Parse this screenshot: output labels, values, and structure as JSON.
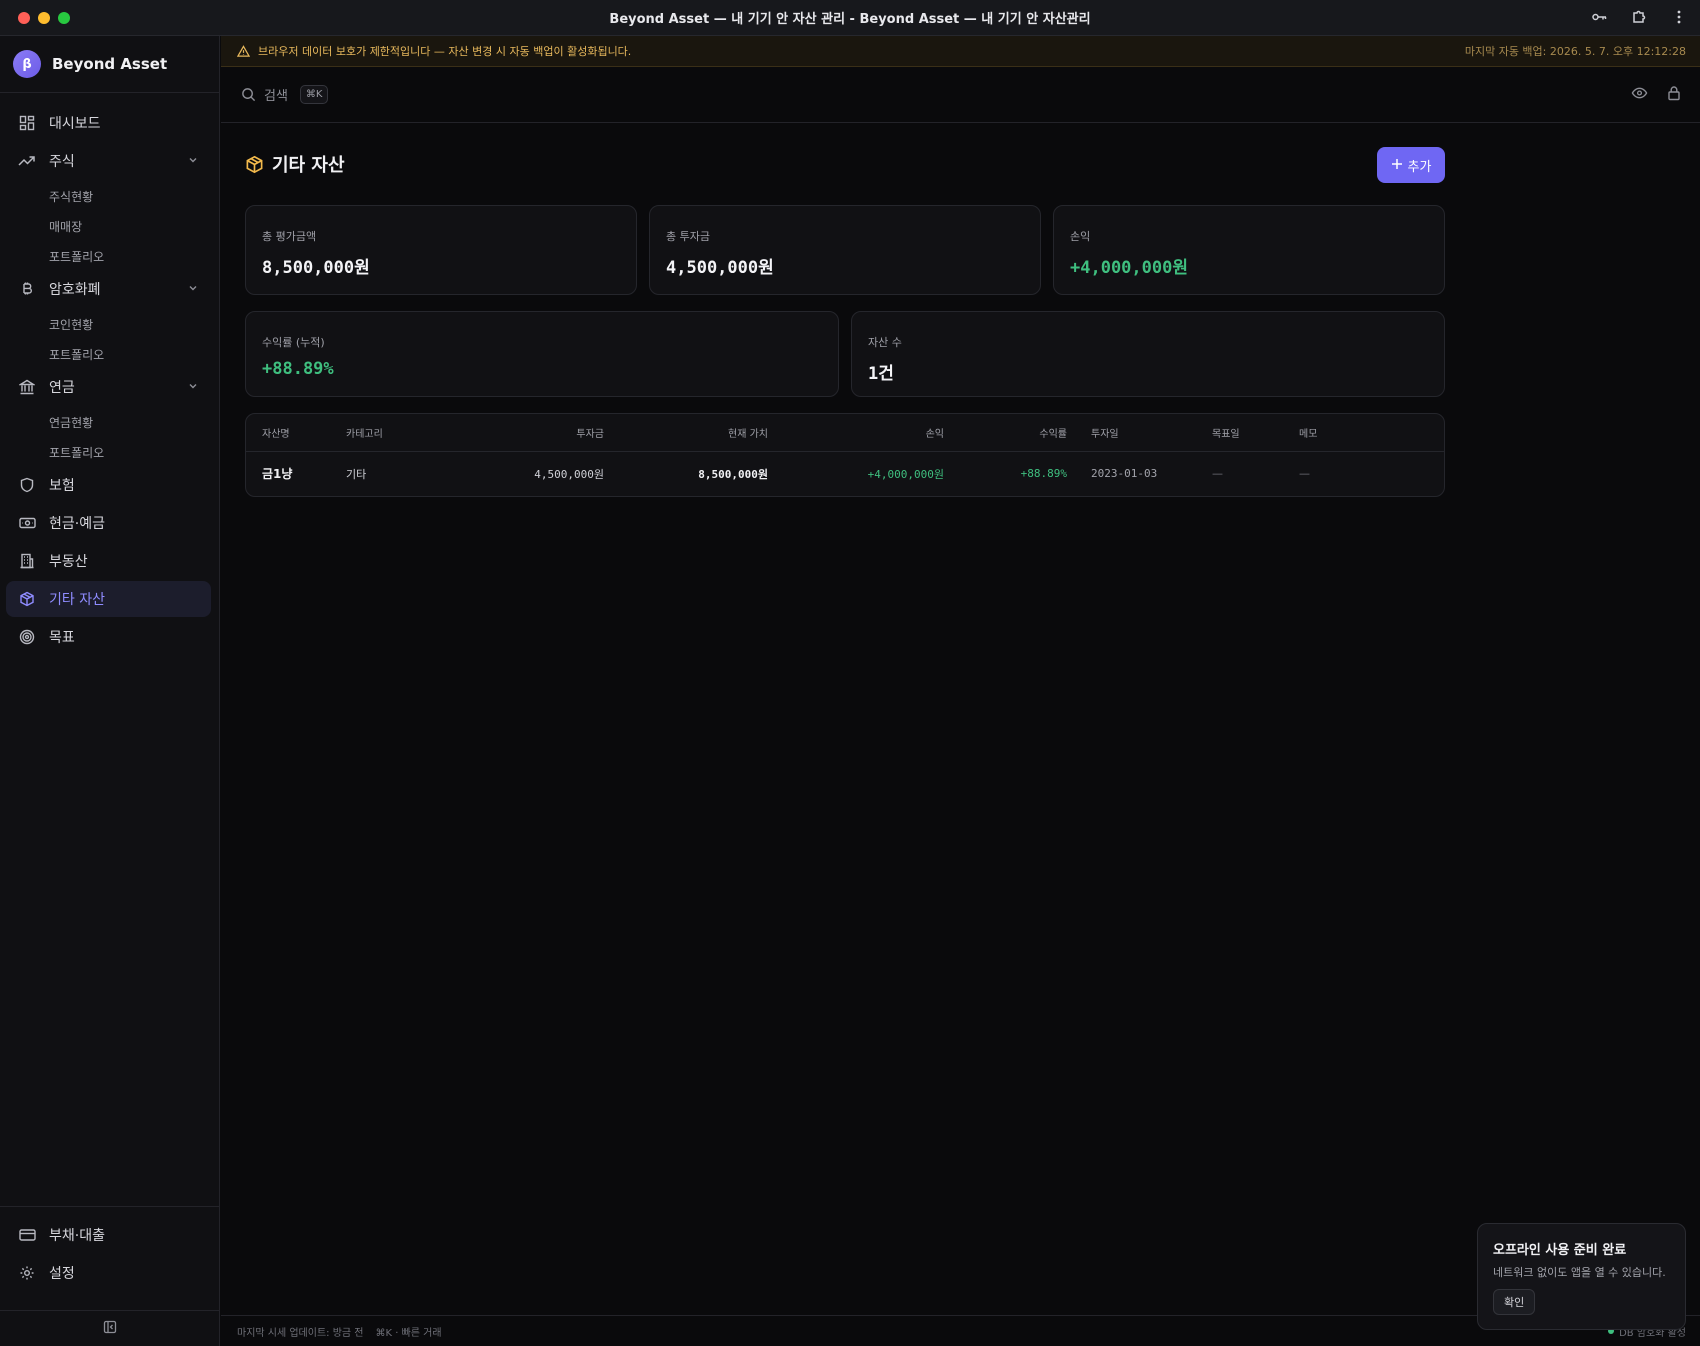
{
  "window": {
    "title": "Beyond Asset — 내 기기 안 자산 관리 - Beyond Asset — 내 기기 안 자산관리"
  },
  "sidebar": {
    "brand": {
      "logo": "β",
      "name": "Beyond Asset"
    },
    "items": [
      {
        "label": "대시보드",
        "icon": "dashboard-icon"
      },
      {
        "label": "주식",
        "icon": "trending-up-icon",
        "children": [
          "주식현황",
          "매매장",
          "포트폴리오"
        ]
      },
      {
        "label": "암호화폐",
        "icon": "bitcoin-icon",
        "children": [
          "코인현황",
          "포트폴리오"
        ]
      },
      {
        "label": "연금",
        "icon": "bank-icon",
        "children": [
          "연금현황",
          "포트폴리오"
        ]
      },
      {
        "label": "보험",
        "icon": "shield-icon"
      },
      {
        "label": "현금·예금",
        "icon": "cash-icon"
      },
      {
        "label": "부동산",
        "icon": "building-icon"
      },
      {
        "label": "기타 자산",
        "icon": "box-icon",
        "active": true
      },
      {
        "label": "목표",
        "icon": "target-icon"
      }
    ],
    "bottom": [
      {
        "label": "부채·대출",
        "icon": "credit-card-icon"
      },
      {
        "label": "설정",
        "icon": "gear-icon"
      }
    ]
  },
  "banner": {
    "message": "브라우저 데이터 보호가 제한적입니다 — 자산 변경 시 자동 백업이 활성화됩니다.",
    "last_backup": "마지막 자동 백업: 2026. 5. 7. 오후 12:12:28"
  },
  "topbar": {
    "search_label": "검색",
    "shortcut": "⌘K"
  },
  "page": {
    "title": "기타 자산",
    "add_button": "추가",
    "summary": {
      "total_value": {
        "label": "총 평가금액",
        "value": "8,500,000원"
      },
      "total_invested": {
        "label": "총 투자금",
        "value": "4,500,000원"
      },
      "profit": {
        "label": "손익",
        "value": "+4,000,000원"
      },
      "return_rate": {
        "label": "수익률 (누적)",
        "value": "+88.89%"
      },
      "asset_count": {
        "label": "자산 수",
        "value": "1건"
      }
    },
    "table": {
      "columns": [
        "자산명",
        "카테고리",
        "투자금",
        "현재 가치",
        "손익",
        "수익률",
        "투자일",
        "목표일",
        "메모"
      ],
      "rows": [
        [
          "금1냥",
          "기타",
          "4,500,000원",
          "8,500,000원",
          "+4,000,000원",
          "+88.89%",
          "2023-01-03",
          "—",
          "—"
        ]
      ]
    }
  },
  "toast": {
    "title": "오프라인 사용 준비 완료",
    "message": "네트워크 없이도 앱을 열 수 있습니다.",
    "button": "확인"
  },
  "statusbar": {
    "last_update": "마지막 시세 업데이트: 방금 전",
    "shortcut_hint": "⌘K · 빠른 거래",
    "db_status": "DB 암호화 활성"
  },
  "colors": {
    "accent": "#6f67f3",
    "positive": "#3fbf7f",
    "warning": "#e7b85c"
  }
}
